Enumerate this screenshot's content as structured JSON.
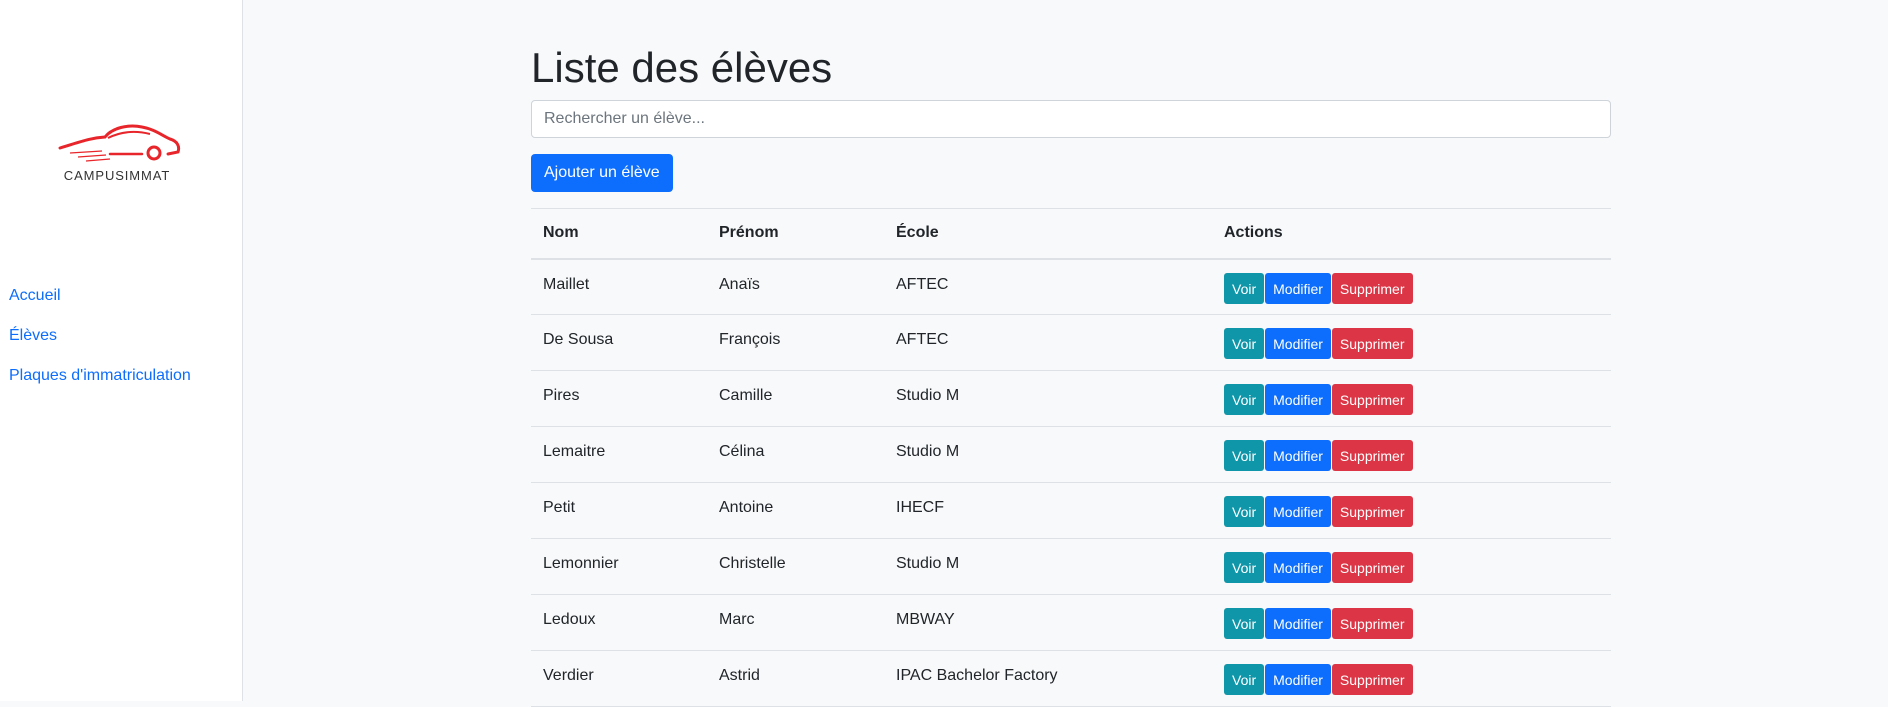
{
  "sidebar": {
    "logo_text": "CAMPUSIMMAT",
    "nav": [
      "Accueil",
      "Élèves",
      "Plaques d'immatriculation"
    ]
  },
  "main": {
    "title": "Liste des élèves",
    "search_placeholder": "Rechercher un élève...",
    "add_button": "Ajouter un élève",
    "columns": [
      "Nom",
      "Prénom",
      "École",
      "Actions"
    ],
    "action_labels": {
      "view": "Voir",
      "edit": "Modifier",
      "delete": "Supprimer"
    },
    "rows": [
      [
        "Maillet",
        "Anaïs",
        "AFTEC"
      ],
      [
        "De Sousa",
        "François",
        "AFTEC"
      ],
      [
        "Pires",
        "Camille",
        "Studio M"
      ],
      [
        "Lemaitre",
        "Célina",
        "Studio M"
      ],
      [
        "Petit",
        "Antoine",
        "IHECF"
      ],
      [
        "Lemonnier",
        "Christelle",
        "Studio M"
      ],
      [
        "Ledoux",
        "Marc",
        "MBWAY"
      ],
      [
        "Verdier",
        "Astrid",
        "IPAC Bachelor Factory"
      ]
    ]
  },
  "colors": {
    "primary": "#0d6efd",
    "info": "#0f96a8",
    "danger": "#dc3545",
    "logo": "#e8252a"
  }
}
